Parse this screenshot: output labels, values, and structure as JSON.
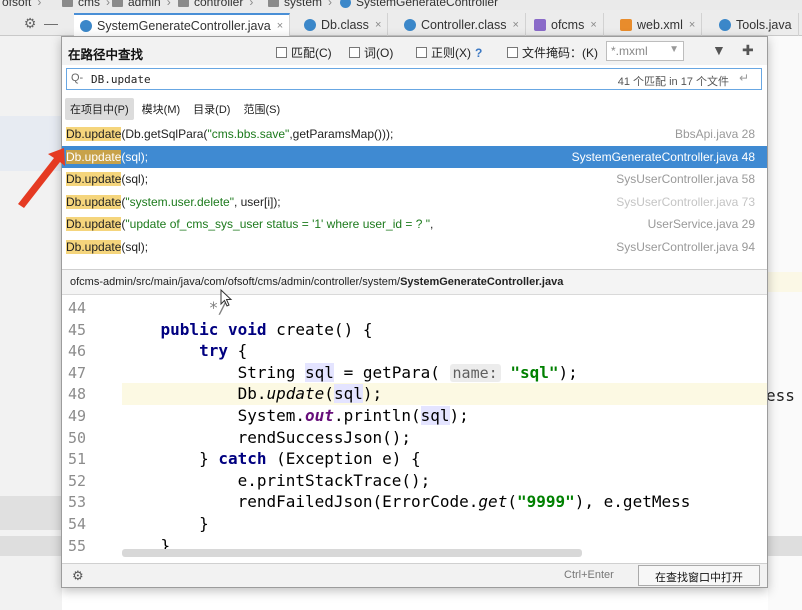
{
  "breadcrumbs": [
    "ofsoft",
    "cms",
    "admin",
    "controller",
    "system",
    "SystemGenerateController"
  ],
  "editor_tabs": [
    {
      "label": "SystemGenerateController.java",
      "icon": "class-icon",
      "active": true
    },
    {
      "label": "Db.class",
      "icon": "class-icon",
      "active": false
    },
    {
      "label": "Controller.class",
      "icon": "class-icon",
      "active": false
    },
    {
      "label": "ofcms",
      "icon": "module-icon",
      "active": false
    },
    {
      "label": "web.xml",
      "icon": "xml-icon",
      "active": false
    },
    {
      "label": "Tools.java",
      "icon": "class-icon",
      "active": false
    }
  ],
  "tab_close_glyph": "×",
  "find_popup": {
    "title": "在路径中查找",
    "options": {
      "match_case": "匹配(C)",
      "words": "词(O)",
      "regex": "正则(X)",
      "regex_help": "?",
      "file_mask": "文件掩码：(K)",
      "file_mask_value": "*.mxml"
    },
    "search_query": "DB.update",
    "match_count": "41 个匹配 in 17 个文件",
    "scopes": [
      "在项目中(P)",
      "模块(M)",
      "目录(D)",
      "范围(S)"
    ],
    "active_scope": 0,
    "results": [
      {
        "match": "Db.update",
        "rest_before": "(Db.getSqlPara(",
        "string": "\"cms.bbs.save\"",
        "rest_after": ",getParamsMap()));",
        "file": "BbsApi.java 28",
        "selected": false,
        "dim": false
      },
      {
        "match": "Db.update",
        "rest_before": "(sql);",
        "string": "",
        "rest_after": "",
        "file": "SystemGenerateController.java 48",
        "selected": true,
        "dim": false
      },
      {
        "match": "Db.update",
        "rest_before": "(sql);",
        "string": "",
        "rest_after": "",
        "file": "SysUserController.java 58",
        "selected": false,
        "dim": false
      },
      {
        "match": "Db.update",
        "rest_before": "(",
        "string": "\"system.user.delete\"",
        "rest_after": ", user[i]);",
        "file": "SysUserController.java 73",
        "selected": false,
        "dim": true
      },
      {
        "match": "Db.update",
        "rest_before": "(",
        "string": "\"update of_cms_sys_user  status = '1'  where user_id = ? \"",
        "rest_after": ",",
        "file": "UserService.java 29",
        "selected": false,
        "dim": false
      },
      {
        "match": "Db.update",
        "rest_before": "(sql);",
        "string": "",
        "rest_after": "",
        "file": "SysUserController.java 94",
        "selected": false,
        "dim": false
      }
    ],
    "file_path_prefix": "ofcms-admin/src/main/java/com/ofsoft/cms/admin/controller/system/",
    "file_path_name": "SystemGenerateController.java",
    "code_lines": [
      {
        "num": "44",
        "parts": [
          {
            "t": "         */",
            "c": "cmt"
          }
        ]
      },
      {
        "num": "45",
        "parts": [
          {
            "t": "    ",
            "c": ""
          },
          {
            "t": "public",
            "c": "kw"
          },
          {
            "t": " ",
            "c": ""
          },
          {
            "t": "void",
            "c": "kw"
          },
          {
            "t": " create() {",
            "c": ""
          }
        ]
      },
      {
        "num": "46",
        "parts": [
          {
            "t": "        ",
            "c": ""
          },
          {
            "t": "try",
            "c": "kw"
          },
          {
            "t": " {",
            "c": ""
          }
        ]
      },
      {
        "num": "47",
        "parts": [
          {
            "t": "            String ",
            "c": ""
          },
          {
            "t": "sql",
            "c": "varhl"
          },
          {
            "t": " = getPara( ",
            "c": ""
          },
          {
            "t": "name:",
            "c": "hint"
          },
          {
            "t": " ",
            "c": ""
          },
          {
            "t": "\"sql\"",
            "c": "sq"
          },
          {
            "t": ");",
            "c": ""
          }
        ]
      },
      {
        "num": "48",
        "cur": true,
        "parts": [
          {
            "t": "            Db.",
            "c": ""
          },
          {
            "t": "update",
            "c": "it"
          },
          {
            "t": "(",
            "c": ""
          },
          {
            "t": "sql",
            "c": "varhl"
          },
          {
            "t": ");",
            "c": ""
          }
        ]
      },
      {
        "num": "49",
        "parts": [
          {
            "t": "            System.",
            "c": ""
          },
          {
            "t": "out",
            "c": "fld"
          },
          {
            "t": ".println(",
            "c": ""
          },
          {
            "t": "sql",
            "c": "varhl"
          },
          {
            "t": ");",
            "c": ""
          }
        ]
      },
      {
        "num": "50",
        "parts": [
          {
            "t": "            rendSuccessJson();",
            "c": ""
          }
        ]
      },
      {
        "num": "51",
        "parts": [
          {
            "t": "        } ",
            "c": ""
          },
          {
            "t": "catch",
            "c": "kw"
          },
          {
            "t": " (Exception e) {",
            "c": ""
          }
        ]
      },
      {
        "num": "52",
        "parts": [
          {
            "t": "            e.printStackTrace();",
            "c": ""
          }
        ]
      },
      {
        "num": "53",
        "parts": [
          {
            "t": "            rendFailedJson(ErrorCode.",
            "c": ""
          },
          {
            "t": "get",
            "c": "it"
          },
          {
            "t": "(",
            "c": ""
          },
          {
            "t": "\"9999\"",
            "c": "sq"
          },
          {
            "t": "), e.getMess",
            "c": ""
          }
        ]
      },
      {
        "num": "54",
        "parts": [
          {
            "t": "        }",
            "c": ""
          }
        ]
      },
      {
        "num": "55",
        "parts": [
          {
            "t": "    }",
            "c": ""
          }
        ]
      }
    ],
    "footer": {
      "shortcut_hint": "Ctrl+Enter",
      "open_button": "在查找窗口中打开"
    }
  },
  "background_cut_text": "ess",
  "icons": {
    "gear": "⚙",
    "filter": "▼",
    "pin": "✚",
    "return": "↵",
    "search": "Q-"
  },
  "colors": {
    "selection": "#3f8ad2",
    "match_highlight": "#f5d57c",
    "keyword": "#000080",
    "string": "#008000",
    "arrow": "#e53a22"
  }
}
